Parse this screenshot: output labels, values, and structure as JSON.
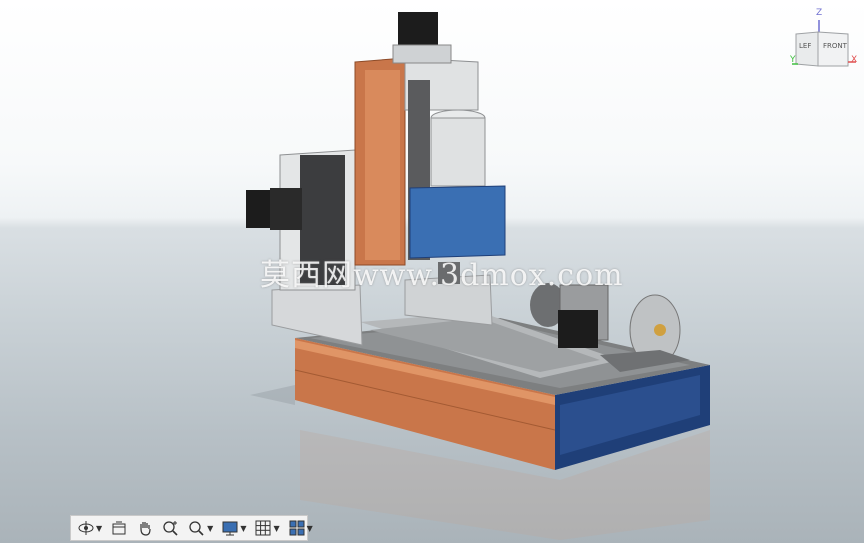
{
  "watermark": {
    "text": "莫西网www.3dmox.com"
  },
  "viewcube": {
    "face_left": "LEF",
    "face_front": "FRONT",
    "axis_z": "Z",
    "axis_x": "X",
    "axis_y": "Y",
    "colors": {
      "z": "#6f6fd0",
      "x": "#e05050",
      "y": "#40c040"
    }
  },
  "toolbar": {
    "buttons": [
      {
        "name": "orbit",
        "icon": "orbit-icon",
        "has_dropdown": true
      },
      {
        "name": "view-slice",
        "icon": "slice-icon",
        "has_dropdown": false
      },
      {
        "name": "pan",
        "icon": "pan-hand-icon",
        "has_dropdown": false
      },
      {
        "name": "zoom",
        "icon": "zoom-icon",
        "has_dropdown": false
      },
      {
        "name": "zoom-window",
        "icon": "zoom-window-icon",
        "has_dropdown": true
      },
      {
        "name": "display-style",
        "icon": "display-monitor-icon",
        "has_dropdown": true
      },
      {
        "name": "grid",
        "icon": "grid-icon",
        "has_dropdown": true
      },
      {
        "name": "viewports",
        "icon": "viewports-icon",
        "has_dropdown": true
      }
    ]
  },
  "colors": {
    "base_wood": "#c9764a",
    "base_blue": "#1f3f78",
    "spindle_blue": "#3a6fb3",
    "aluminum": "#c9ced2",
    "stepper_black": "#1c1c1c"
  }
}
